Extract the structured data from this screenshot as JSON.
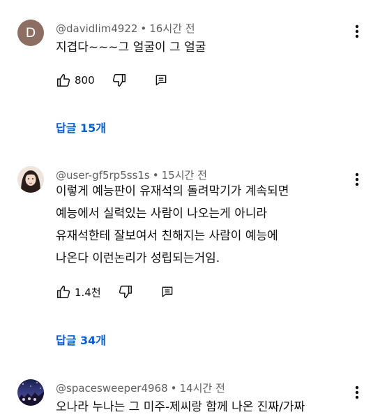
{
  "comments": [
    {
      "author": "@davidlim4922",
      "time": "16시간 전",
      "avatar_letter": "D",
      "lines": [
        "지겹다~~~그 얼굴이 그 얼굴"
      ],
      "likes": "800",
      "replies": "답글 15개"
    },
    {
      "author": "@user-gf5rp5ss1s",
      "time": "15시간 전",
      "lines": [
        "이렇게 예능판이 유재석의 돌려막기가 계속되면",
        "예능에서 실력있는 사람이 나오는게 아니라",
        "유재석한테 잘보여서 친해지는 사람이 예능에",
        "나온다 이런논리가 성립되는거임."
      ],
      "likes": "1.4천",
      "replies": "답글 34개"
    },
    {
      "author": "@spacesweeper4968",
      "time": "14시간 전",
      "lines": [
        "오나라 누나는 그 미주-제씨랑 함께 나온 진짜/가짜"
      ]
    }
  ],
  "separator": "•",
  "colors": {
    "link": "#065fd4",
    "meta": "#606060",
    "avatar_d": "#8d6e63"
  },
  "icons": [
    "thumbs-up-icon",
    "thumbs-down-icon",
    "reply-icon",
    "more-vert-icon"
  ]
}
